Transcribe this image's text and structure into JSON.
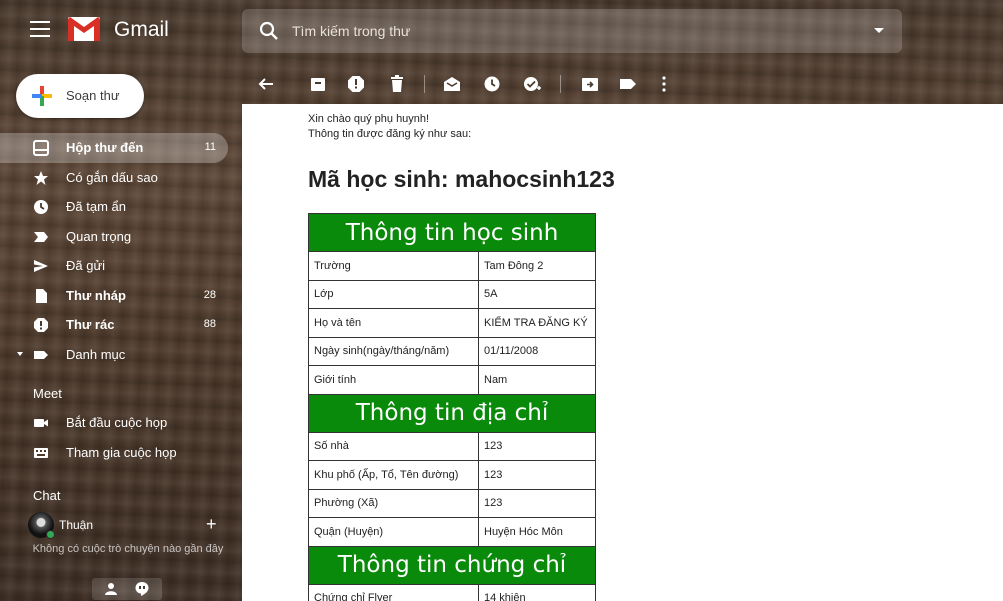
{
  "header": {
    "app_name": "Gmail",
    "search_placeholder": "Tìm kiếm trong thư"
  },
  "sidebar": {
    "compose_label": "Soạn thư",
    "items": [
      {
        "label": "Hộp thư đến",
        "count": "11",
        "bold": true,
        "active": true,
        "icon": "inbox-icon"
      },
      {
        "label": "Có gắn dấu sao",
        "count": "",
        "bold": false,
        "active": false,
        "icon": "star-icon"
      },
      {
        "label": "Đã tạm ẩn",
        "count": "",
        "bold": false,
        "active": false,
        "icon": "clock-icon"
      },
      {
        "label": "Quan trọng",
        "count": "",
        "bold": false,
        "active": false,
        "icon": "important-icon"
      },
      {
        "label": "Đã gửi",
        "count": "",
        "bold": false,
        "active": false,
        "icon": "send-icon"
      },
      {
        "label": "Thư nháp",
        "count": "28",
        "bold": true,
        "active": false,
        "icon": "draft-icon"
      },
      {
        "label": "Thư rác",
        "count": "88",
        "bold": true,
        "active": false,
        "icon": "spam-icon"
      },
      {
        "label": "Danh mục",
        "count": "",
        "bold": false,
        "active": false,
        "icon": "label-icon"
      }
    ],
    "meet": {
      "title": "Meet",
      "start_label": "Bắt đầu cuộc họp",
      "join_label": "Tham gia cuộc họp"
    },
    "chat": {
      "title": "Chat",
      "user_name": "Thuận",
      "empty_text": "Không có cuộc trò chuyện nào gần đây"
    }
  },
  "email": {
    "greeting": "Xin chào quý phụ huynh!",
    "intro": "Thông tin được đăng ký như sau:",
    "code_title": "Mã học sinh: mahocsinh123",
    "sections": [
      {
        "title": "Thông tin học sinh",
        "rows": [
          {
            "key": "Trường",
            "value": "Tam Đông 2"
          },
          {
            "key": "Lớp",
            "value": "5A"
          },
          {
            "key": "Họ và tên",
            "value": "KIỂM TRA ĐĂNG KÝ"
          },
          {
            "key": "Ngày sinh(ngày/tháng/năm)",
            "value": "01/11/2008"
          },
          {
            "key": "Giới tính",
            "value": "Nam"
          }
        ]
      },
      {
        "title": "Thông tin địa chỉ",
        "rows": [
          {
            "key": "Số nhà",
            "value": "123"
          },
          {
            "key": "Khu phố (Ấp, Tổ, Tên đường)",
            "value": "123"
          },
          {
            "key": "Phường (Xã)",
            "value": "123"
          },
          {
            "key": "Quận (Huyện)",
            "value": "Huyện Hóc Môn"
          }
        ]
      },
      {
        "title": "Thông tin chứng chỉ",
        "rows": [
          {
            "key": "Chứng chỉ Flyer",
            "value": "14 khiên"
          }
        ]
      }
    ]
  },
  "colors": {
    "table_header_green": "#0a8a0a",
    "gmail_red": "#d93025"
  }
}
